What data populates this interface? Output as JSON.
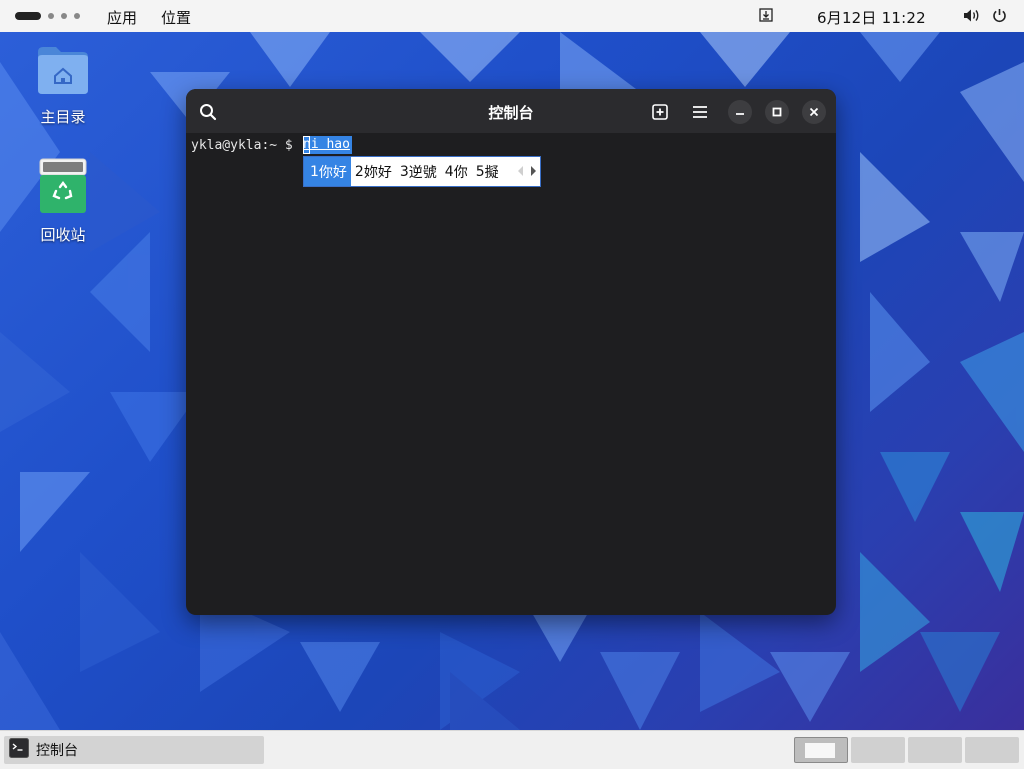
{
  "topbar": {
    "menu_apps": "应用",
    "menu_places": "位置",
    "clock": "6月12日  11:22",
    "icons": [
      "activities-indicator",
      "download-icon",
      "volume-icon",
      "power-icon"
    ]
  },
  "desktop": {
    "icons": [
      {
        "label": "主目录",
        "icon": "home-folder-icon"
      },
      {
        "label": "回收站",
        "icon": "trash-icon"
      }
    ]
  },
  "terminal": {
    "title": "控制台",
    "prompt": "ykla@ykla:~ $ ",
    "preedit": "ni hao",
    "header_buttons": [
      "search-icon",
      "new-tab-icon",
      "menu-icon",
      "minimize-icon",
      "maximize-icon",
      "close-icon"
    ]
  },
  "ime": {
    "candidates": [
      {
        "index": "1",
        "text": "你好",
        "selected": true
      },
      {
        "index": "2",
        "text": "妳好",
        "selected": false
      },
      {
        "index": "3",
        "text": "逆號",
        "selected": false
      },
      {
        "index": "4",
        "text": "你",
        "selected": false
      },
      {
        "index": "5",
        "text": "擬",
        "selected": false
      }
    ],
    "arrows": [
      "prev-page-icon",
      "next-page-icon"
    ]
  },
  "taskbar": {
    "window_label": "控制台",
    "workspaces": 4,
    "active_workspace": 1
  },
  "colors": {
    "accent": "#3584e4",
    "topbar_bg": "#f4f4f4",
    "terminal_bg": "#1e1e20",
    "terminal_header": "#2b2b2e",
    "trash_green": "#2fb36b"
  }
}
